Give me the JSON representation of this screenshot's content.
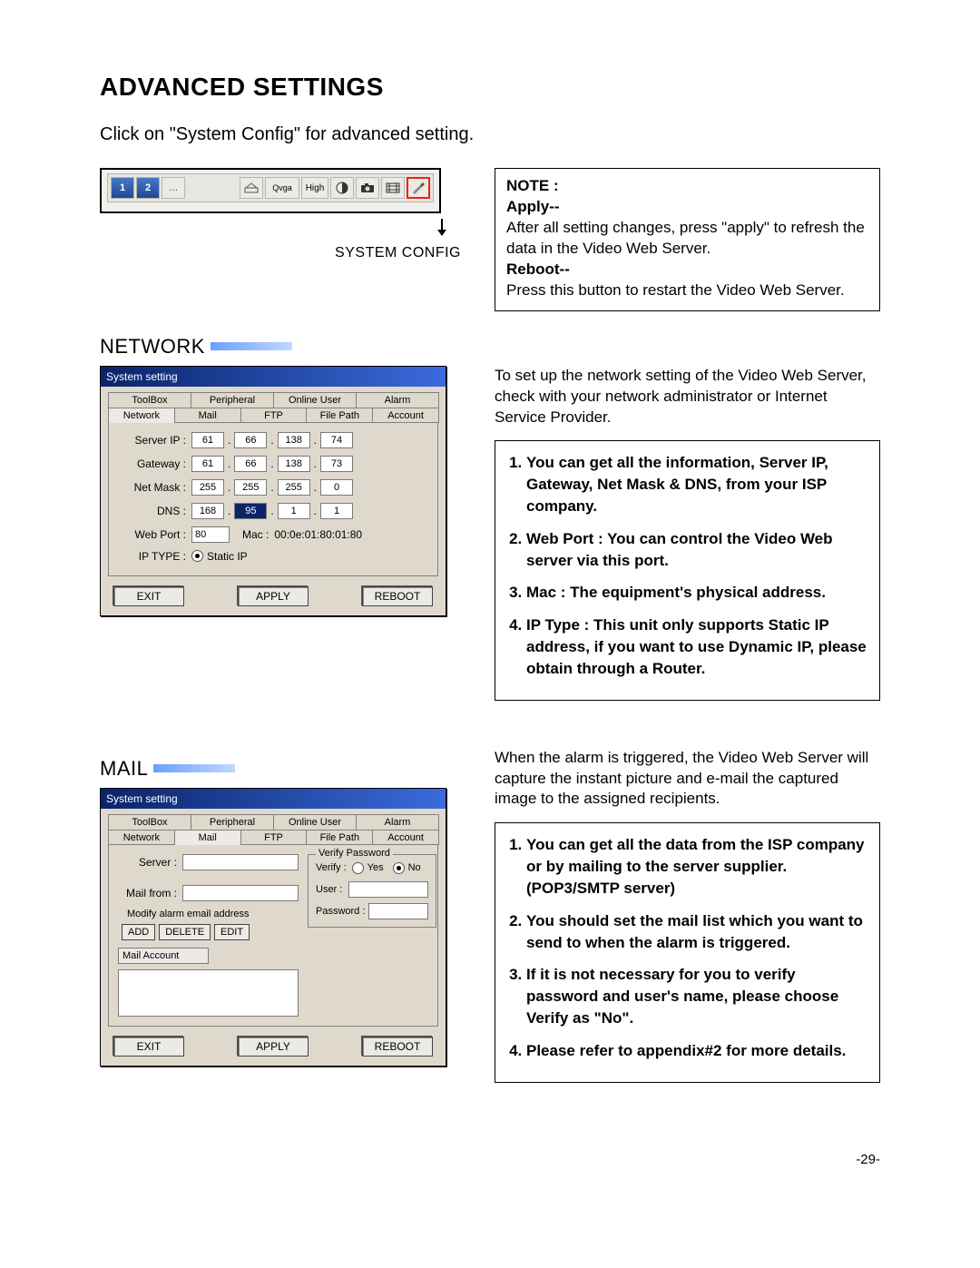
{
  "title": "ADVANCED SETTINGS",
  "intro": "Click on \"System Config\" for advanced setting.",
  "toolbar": {
    "btn1": "1",
    "btn2": "2",
    "qvga": "Qvga",
    "high": "High",
    "system_config_label": "SYSTEM CONFIG"
  },
  "notebox1": {
    "heading": "NOTE :",
    "apply_label": "Apply--",
    "apply_text": "After all setting changes, press \"apply\" to refresh the data in the Video Web Server.",
    "reboot_label": "Reboot--",
    "reboot_text": "Press this button to restart the Video Web Server."
  },
  "network": {
    "section": "NETWORK",
    "dialog_title": "System setting",
    "tabs_row1": [
      "ToolBox",
      "Peripheral",
      "Online User",
      "Alarm"
    ],
    "tabs_row2": [
      "Network",
      "Mail",
      "FTP",
      "File Path",
      "Account"
    ],
    "active_tab_index": 0,
    "fields": {
      "server_ip": {
        "label": "Server IP :",
        "oct": [
          "61",
          "66",
          "138",
          "74"
        ]
      },
      "gateway": {
        "label": "Gateway :",
        "oct": [
          "61",
          "66",
          "138",
          "73"
        ]
      },
      "netmask": {
        "label": "Net Mask :",
        "oct": [
          "255",
          "255",
          "255",
          "0"
        ]
      },
      "dns": {
        "label": "DNS :",
        "oct": [
          "168",
          "95",
          "1",
          "1"
        ],
        "highlight_index": 1
      },
      "webport": {
        "label": "Web Port :",
        "value": "80",
        "mac_label": "Mac :",
        "mac_value": "00:0e:01:80:01:80"
      },
      "iptype": {
        "label": "IP TYPE :",
        "option": "Static IP"
      }
    },
    "buttons": {
      "exit": "EXIT",
      "apply": "APPLY",
      "reboot": "REBOOT"
    },
    "right_paragraph": "To set up the network setting of the Video Web Server, check with your network administrator or Internet Service Provider.",
    "right_list": [
      "You can get all the information, Server IP, Gateway, Net Mask & DNS, from your ISP company.",
      "Web Port : You can control the Video Web server via this port.",
      "Mac : The equipment's physical address.",
      "IP Type : This unit only supports Static IP address, if you want to use Dynamic IP, please obtain through a Router."
    ]
  },
  "mail": {
    "section": "MAIL",
    "dialog_title": "System setting",
    "tabs_row1": [
      "ToolBox",
      "Peripheral",
      "Online User",
      "Alarm"
    ],
    "tabs_row2": [
      "Network",
      "Mail",
      "FTP",
      "File Path",
      "Account"
    ],
    "active_tab_index": 1,
    "fields": {
      "server": "Server :",
      "mail_from": "Mail from :",
      "modify_label": "Modify alarm email address",
      "add": "ADD",
      "delete": "DELETE",
      "edit": "EDIT",
      "mail_account": "Mail Account",
      "verify_group": "Verify Password",
      "verify_label": "Verify :",
      "verify_yes": "Yes",
      "verify_no": "No",
      "verify_checked": "no",
      "user_label": "User :",
      "password_label": "Password :"
    },
    "buttons": {
      "exit": "EXIT",
      "apply": "APPLY",
      "reboot": "REBOOT"
    },
    "right_paragraph": "When the alarm is triggered, the Video Web Server will capture the instant picture and e-mail the captured image to the assigned recipients.",
    "right_list": [
      "You can get all the data from the ISP company or by mailing to the server supplier.(POP3/SMTP server)",
      "You should set the mail list which you want to send to when the alarm is triggered.",
      "If it is not necessary for you to verify password and user's name, please choose Verify as  \"No\".",
      "Please refer to appendix#2 for more details."
    ]
  },
  "page_number": "-29-"
}
